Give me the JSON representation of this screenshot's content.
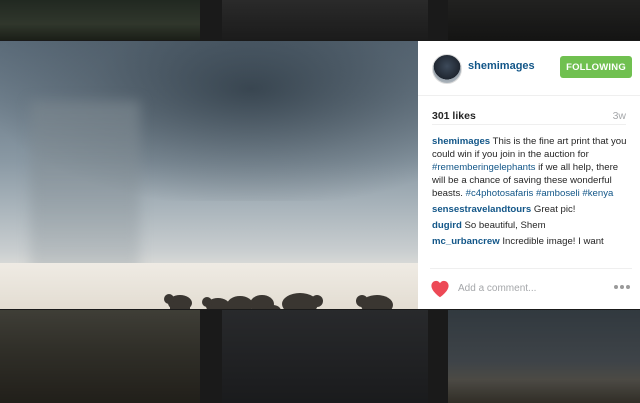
{
  "post": {
    "username": "shemimages",
    "follow_label": "FOLLOWING",
    "likes": "301 likes",
    "age": "3w",
    "caption": {
      "user": "shemimages",
      "text_1": "This is the fine art print that you could win if you join in the auction for",
      "tag_1": "#rememberingelephants",
      "text_2": "if we all help, there will be a chance of saving these wonderful beasts.",
      "tag_2": "#c4photosafaris",
      "tag_3": "#amboseli",
      "tag_4": "#kenya"
    },
    "comments": [
      {
        "user": "sensestravelandtours",
        "text": "Great pic!"
      },
      {
        "user": "dugird",
        "text": "So beautiful, Shem"
      },
      {
        "user": "mc_urbancrew",
        "text": "Incredible image! I want"
      }
    ],
    "comment_placeholder": "Add a comment..."
  },
  "icons": {
    "like": "heart-icon",
    "more": "more-options-icon",
    "heart_color": "#ed4956"
  },
  "colors": {
    "link": "#125688",
    "follow": "#70c050"
  }
}
